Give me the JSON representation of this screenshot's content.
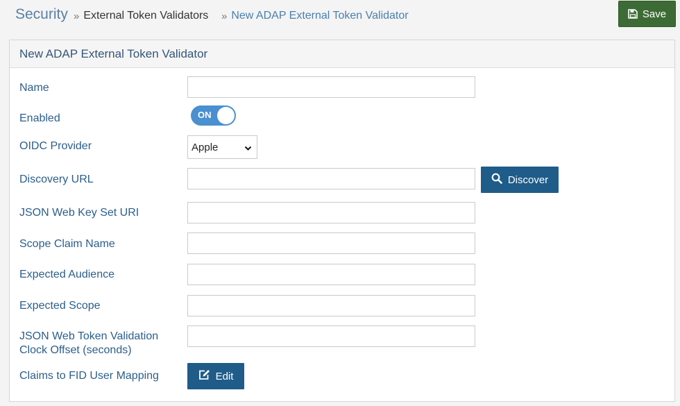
{
  "breadcrumb": {
    "root": "Security",
    "items": [
      "External Token Validators",
      "New ADAP External Token Validator"
    ]
  },
  "toolbar": {
    "save_label": "Save",
    "save_icon": "floppy-disk-icon"
  },
  "panel": {
    "title": "New ADAP External Token Validator",
    "fields": {
      "name": {
        "label": "Name",
        "value": ""
      },
      "enabled": {
        "label": "Enabled",
        "state": "ON"
      },
      "oidc_provider": {
        "label": "OIDC Provider",
        "selected": "Apple"
      },
      "discovery_url": {
        "label": "Discovery URL",
        "value": ""
      },
      "jwks_uri": {
        "label": "JSON Web Key Set URI",
        "value": ""
      },
      "scope_claim_name": {
        "label": "Scope Claim Name",
        "value": ""
      },
      "expected_audience": {
        "label": "Expected Audience",
        "value": ""
      },
      "expected_scope": {
        "label": "Expected Scope",
        "value": ""
      },
      "clock_offset": {
        "label_line1": "JSON Web Token Validation",
        "label_line2": "Clock Offset (seconds)",
        "value": ""
      },
      "claims_mapping": {
        "label": "Claims to FID User Mapping"
      }
    },
    "discover_label": "Discover",
    "edit_label": "Edit"
  },
  "colors": {
    "accent": "#1f5c89",
    "save": "#3d6b35",
    "toggle": "#4a8fd0",
    "label": "#2b5e8c"
  }
}
